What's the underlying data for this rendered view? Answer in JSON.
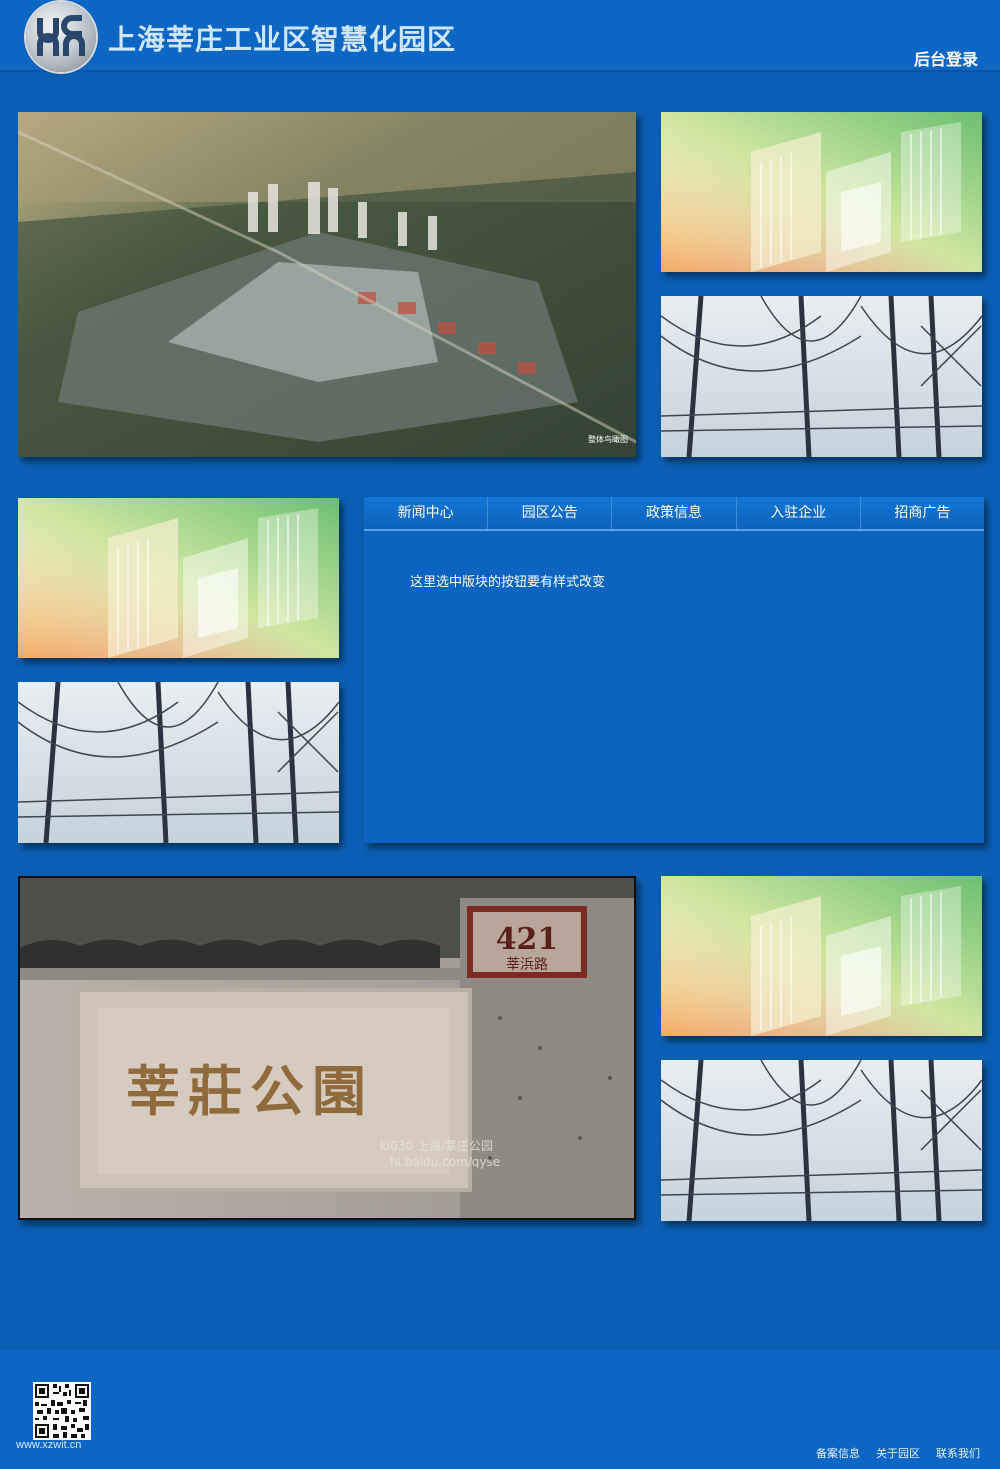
{
  "header": {
    "title": "上海莘庄工业区智慧化园区",
    "admin_login": "后台登录"
  },
  "tabs": [
    {
      "label": "新闻中心"
    },
    {
      "label": "园区公告"
    },
    {
      "label": "政策信息"
    },
    {
      "label": "入驻企业"
    },
    {
      "label": "招商广告"
    }
  ],
  "panel": {
    "text": "这里选中版块的按钮要有样式改变"
  },
  "images": {
    "aerial_caption": "整体鸟瞰图",
    "park_sign_number": "421",
    "park_sign_road": "莘浜路",
    "park_sign_text": "莘莊公園",
    "park_watermark_1": "ki030 上海/莘庄公园",
    "park_watermark_2": "hi.baidu.com/qyse"
  },
  "footer": {
    "site_url": "www.xzwit.cn",
    "links": [
      {
        "label": "备案信息"
      },
      {
        "label": "关于园区"
      },
      {
        "label": "联系我们"
      }
    ]
  },
  "colors": {
    "page_background": "#0a5fb4",
    "header_background": "#0c67c4",
    "title_color": "#cfe6ff"
  }
}
